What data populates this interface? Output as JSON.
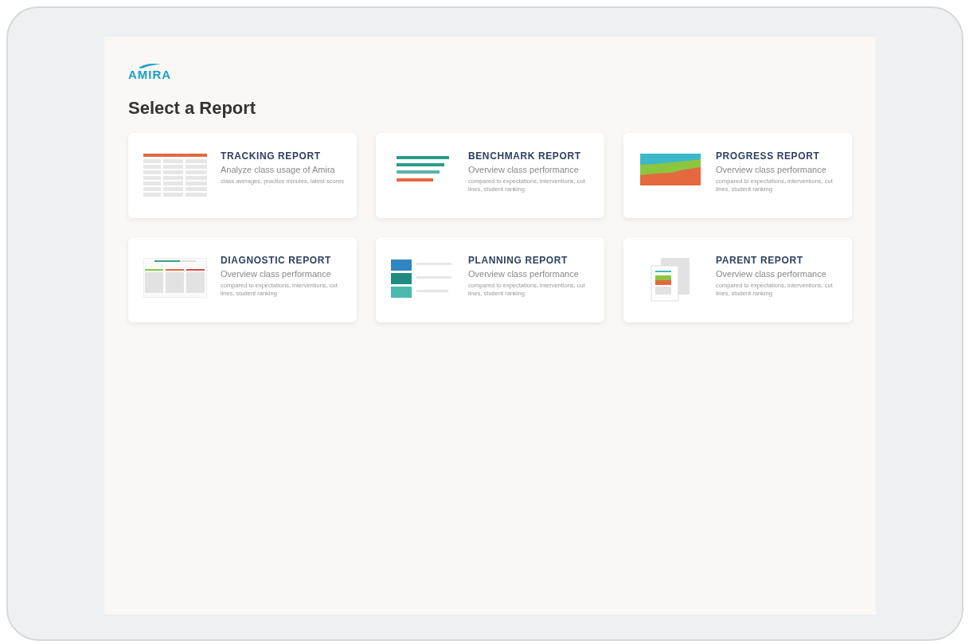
{
  "logo": {
    "text": "AMIRA"
  },
  "heading": "Select a Report",
  "reports": [
    {
      "kind": "tracking",
      "title": "TRACKING REPORT",
      "description": "Analyze class usage of Amira",
      "details": "class averages, practice minutes, latest scores"
    },
    {
      "kind": "benchmark",
      "title": "BENCHMARK REPORT",
      "description": "Overview class performance",
      "details": "compared to expectations, interventions, cut lines, student ranking"
    },
    {
      "kind": "progress",
      "title": "PROGRESS REPORT",
      "description": "Overview class performance",
      "details": "compared to expectations, interventions, cut lines, student ranking"
    },
    {
      "kind": "diagnostic",
      "title": "DIAGNOSTIC REPORT",
      "description": "Overview class performance",
      "details": "compared to expectations, interventions, cut lines, student ranking"
    },
    {
      "kind": "planning",
      "title": "PLANNING REPORT",
      "description": "Overview class performance",
      "details": "compared to expectations, interventions, cut lines, student ranking"
    },
    {
      "kind": "parent",
      "title": "PARENT REPORT",
      "description": "Overview class performance",
      "details": "compared to expectations, interventions, cut lines, student ranking"
    }
  ]
}
